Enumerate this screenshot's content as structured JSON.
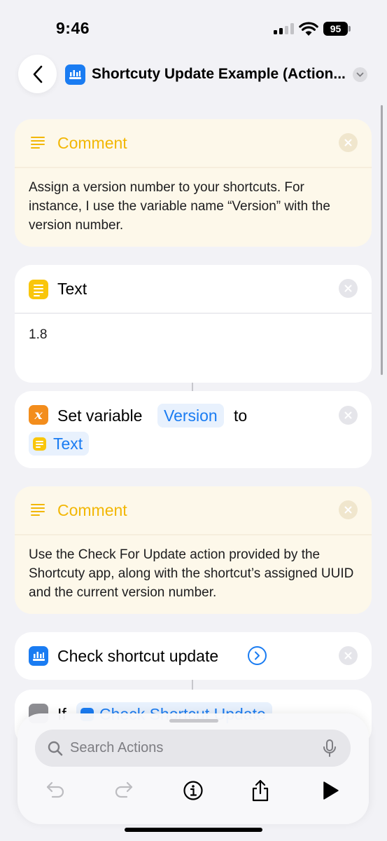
{
  "status_bar": {
    "time": "9:46",
    "battery": "95"
  },
  "nav": {
    "title": "Shortcuty Update Example (Action..."
  },
  "actions": [
    {
      "type": "comment",
      "header": "Comment",
      "text": "Assign a version number to your shortcuts. For instance, I use the variable name “Version” with the version number."
    },
    {
      "type": "text",
      "header": "Text",
      "value": "1.8"
    },
    {
      "type": "set_variable",
      "prefix": "Set variable",
      "variable": "Version",
      "to": "to",
      "input": "Text"
    },
    {
      "type": "comment",
      "header": "Comment",
      "text": "Use the Check For Update action provided by the Shortcuty app, along with the shortcut’s assigned UUID and the current version number."
    },
    {
      "type": "action",
      "header": "Check shortcut update"
    },
    {
      "type": "if",
      "header": "If",
      "input": "Check Shortcut Update"
    }
  ],
  "search": {
    "placeholder": "Search Actions"
  },
  "toolbar": [
    "undo-icon",
    "redo-icon",
    "info-icon",
    "share-icon",
    "play-icon"
  ],
  "colors": {
    "accent": "#1a7cf2",
    "comment": "#f2b705",
    "text_action": "#f9c60c",
    "variable_action": "#f38d1c",
    "background": "#f2f2f6"
  }
}
